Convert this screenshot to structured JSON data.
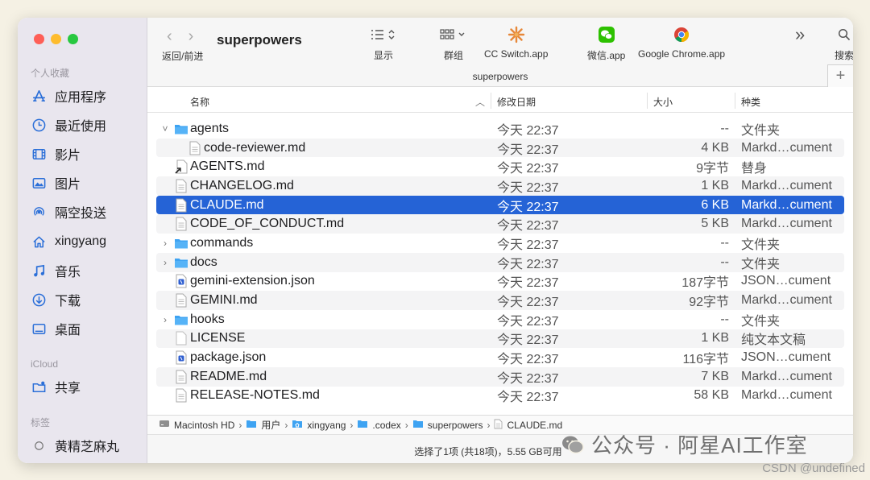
{
  "window": {
    "title": "superpowers",
    "path_title": "superpowers",
    "traffic_colors": [
      "#fe5f57",
      "#febc2e",
      "#28c840"
    ]
  },
  "toolbar": {
    "back_forward_label": "返回/前进",
    "view_label": "显示",
    "group_label": "群组",
    "app1": "CC Switch.app",
    "app2": "微信.app",
    "app3": "Google Chrome.app",
    "search_label": "搜索",
    "more": "»",
    "plus": "+"
  },
  "sidebar": {
    "favorites_label": "个人收藏",
    "items": [
      {
        "label": "应用程序",
        "icon": "applications-icon"
      },
      {
        "label": "最近使用",
        "icon": "clock-icon"
      },
      {
        "label": "影片",
        "icon": "film-icon"
      },
      {
        "label": "图片",
        "icon": "photo-icon"
      },
      {
        "label": "隔空投送",
        "icon": "airdrop-icon"
      },
      {
        "label": "xingyang",
        "icon": "home-icon"
      },
      {
        "label": "音乐",
        "icon": "music-icon"
      },
      {
        "label": "下载",
        "icon": "download-icon"
      },
      {
        "label": "桌面",
        "icon": "desktop-icon"
      }
    ],
    "icloud_label": "iCloud",
    "icloud_items": [
      {
        "label": "共享",
        "icon": "shared-folder-icon"
      }
    ],
    "tags_label": "标签",
    "tag_items": [
      {
        "label": "黄精芝麻丸",
        "icon": "tag-circle-icon"
      }
    ]
  },
  "columns": {
    "name": "名称",
    "modified": "修改日期",
    "size": "大小",
    "kind": "种类"
  },
  "files": [
    {
      "name": "agents",
      "date": "今天 22:37",
      "size": "--",
      "kind": "文件夹",
      "type": "folder",
      "disclosure": "˅",
      "indent": 0
    },
    {
      "name": "code-reviewer.md",
      "date": "今天 22:37",
      "size": "4 KB",
      "kind": "Markd…cument",
      "type": "doc",
      "disclosure": "",
      "indent": 1
    },
    {
      "name": "AGENTS.md",
      "date": "今天 22:37",
      "size": "9字节",
      "kind": "替身",
      "type": "alias",
      "disclosure": "",
      "indent": 0
    },
    {
      "name": "CHANGELOG.md",
      "date": "今天 22:37",
      "size": "1 KB",
      "kind": "Markd…cument",
      "type": "doc",
      "disclosure": "",
      "indent": 0
    },
    {
      "name": "CLAUDE.md",
      "date": "今天 22:37",
      "size": "6 KB",
      "kind": "Markd…cument",
      "type": "doc",
      "disclosure": "",
      "indent": 0,
      "selected": true
    },
    {
      "name": "CODE_OF_CONDUCT.md",
      "date": "今天 22:37",
      "size": "5 KB",
      "kind": "Markd…cument",
      "type": "doc",
      "disclosure": "",
      "indent": 0
    },
    {
      "name": "commands",
      "date": "今天 22:37",
      "size": "--",
      "kind": "文件夹",
      "type": "folder",
      "disclosure": "›",
      "indent": 0
    },
    {
      "name": "docs",
      "date": "今天 22:37",
      "size": "--",
      "kind": "文件夹",
      "type": "folder",
      "disclosure": "›",
      "indent": 0
    },
    {
      "name": "gemini-extension.json",
      "date": "今天 22:37",
      "size": "187字节",
      "kind": "JSON…cument",
      "type": "json",
      "disclosure": "",
      "indent": 0
    },
    {
      "name": "GEMINI.md",
      "date": "今天 22:37",
      "size": "92字节",
      "kind": "Markd…cument",
      "type": "doc",
      "disclosure": "",
      "indent": 0
    },
    {
      "name": "hooks",
      "date": "今天 22:37",
      "size": "--",
      "kind": "文件夹",
      "type": "folder",
      "disclosure": "›",
      "indent": 0
    },
    {
      "name": "LICENSE",
      "date": "今天 22:37",
      "size": "1 KB",
      "kind": "纯文本文稿",
      "type": "blank",
      "disclosure": "",
      "indent": 0
    },
    {
      "name": "package.json",
      "date": "今天 22:37",
      "size": "116字节",
      "kind": "JSON…cument",
      "type": "json",
      "disclosure": "",
      "indent": 0
    },
    {
      "name": "README.md",
      "date": "今天 22:37",
      "size": "7 KB",
      "kind": "Markd…cument",
      "type": "doc",
      "disclosure": "",
      "indent": 0
    },
    {
      "name": "RELEASE-NOTES.md",
      "date": "今天 22:37",
      "size": "58 KB",
      "kind": "Markd…cument",
      "type": "doc",
      "disclosure": "",
      "indent": 0
    }
  ],
  "pathbar": [
    {
      "label": "Macintosh HD",
      "icon": "disk-icon"
    },
    {
      "label": "用户",
      "icon": "folder-icon"
    },
    {
      "label": "xingyang",
      "icon": "home-folder-icon"
    },
    {
      "label": ".codex",
      "icon": "folder-icon"
    },
    {
      "label": "superpowers",
      "icon": "folder-icon"
    },
    {
      "label": "CLAUDE.md",
      "icon": "document-icon"
    }
  ],
  "status": "选择了1项 (共18项)，5.55 GB可用",
  "watermark": "公众号 · 阿星AI工作室",
  "csdn": "CSDN @undefined",
  "colors": {
    "accent": "#2563d6",
    "folder": "#3ea3f2",
    "sidebar_icon": "#2b6fd8"
  }
}
